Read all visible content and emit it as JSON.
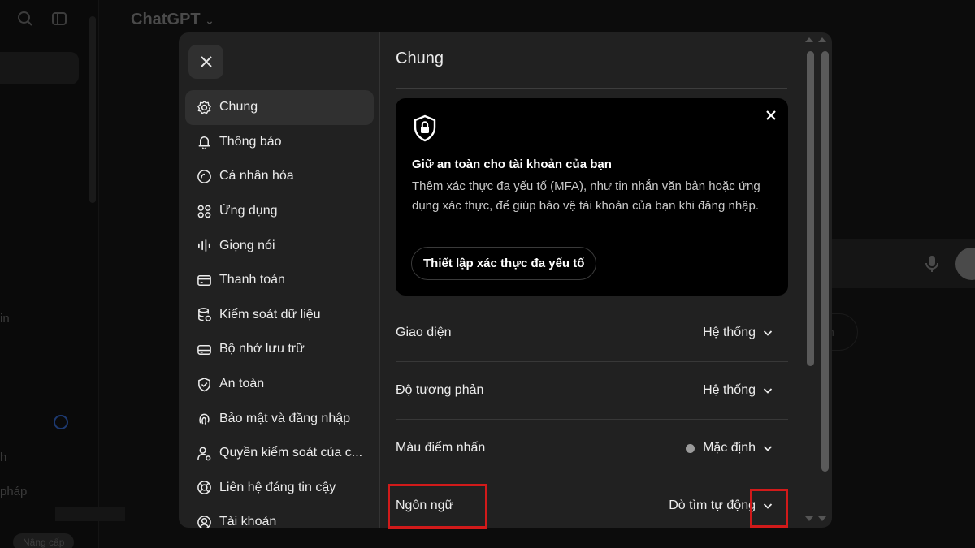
{
  "background": {
    "app_title": "ChatGPT",
    "fragments": [
      "in",
      "h",
      "pháp"
    ],
    "upgrade_label": "Nâng cấp",
    "pill_label": "n"
  },
  "modal": {
    "nav": [
      {
        "label": "Chung",
        "icon": "gear-icon",
        "active": true
      },
      {
        "label": "Thông báo",
        "icon": "bell-icon"
      },
      {
        "label": "Cá nhân hóa",
        "icon": "personalization-icon"
      },
      {
        "label": "Ứng dụng",
        "icon": "apps-grid-icon"
      },
      {
        "label": "Giọng nói",
        "icon": "waveform-icon"
      },
      {
        "label": "Thanh toán",
        "icon": "credit-card-icon"
      },
      {
        "label": "Kiểm soát dữ liệu",
        "icon": "database-icon"
      },
      {
        "label": "Bộ nhớ lưu trữ",
        "icon": "storage-icon"
      },
      {
        "label": "An toàn",
        "icon": "shield-check-icon"
      },
      {
        "label": "Bảo mật và đăng nhập",
        "icon": "fingerprint-icon"
      },
      {
        "label": "Quyền kiểm soát của c...",
        "icon": "parental-control-icon"
      },
      {
        "label": "Liên hệ đáng tin cậy",
        "icon": "lifebuoy-icon"
      },
      {
        "label": "Tài khoản",
        "icon": "user-circle-icon"
      }
    ],
    "content": {
      "title": "Chung",
      "security_card": {
        "title": "Giữ an toàn cho tài khoản của bạn",
        "description": "Thêm xác thực đa yếu tố (MFA), như tin nhắn văn bản hoặc ứng dụng xác thực, để giúp bảo vệ tài khoản của bạn khi đăng nhập.",
        "button_label": "Thiết lập xác thực đa yếu tố"
      },
      "settings": [
        {
          "label": "Giao diện",
          "value": "Hệ thống"
        },
        {
          "label": "Độ tương phản",
          "value": "Hệ thống"
        },
        {
          "label": "Màu điểm nhấn",
          "value": "Mặc định",
          "dot_color": "#9b9b9b"
        },
        {
          "label": "Ngôn ngữ",
          "value": "Dò tìm tự động"
        }
      ]
    }
  },
  "colors": {
    "highlight": "#d11a1a",
    "modal_bg": "#212121",
    "card_bg": "#000000"
  }
}
